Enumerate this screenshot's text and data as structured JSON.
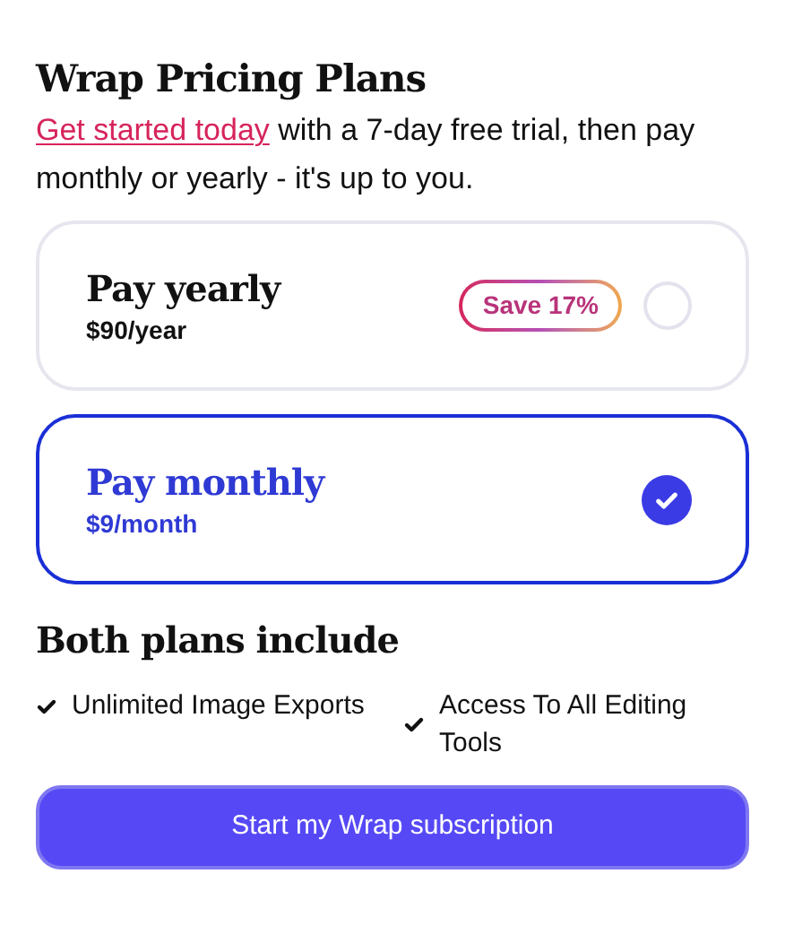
{
  "title": "Wrap Pricing Plans",
  "intro": {
    "link": "Get started today",
    "text": "with a 7-day free trial, then pay monthly or yearly - it's up to you."
  },
  "plans": [
    {
      "name": "Pay yearly",
      "price": "$90/year",
      "badge": "Save 17%",
      "selected": false
    },
    {
      "name": "Pay monthly",
      "price": "$9/month",
      "selected": true
    }
  ],
  "includes": {
    "title": "Both plans include",
    "features": [
      "Unlimited Image Exports",
      "Access To All Editing Tools"
    ]
  },
  "button": "Start my Wrap subscription"
}
